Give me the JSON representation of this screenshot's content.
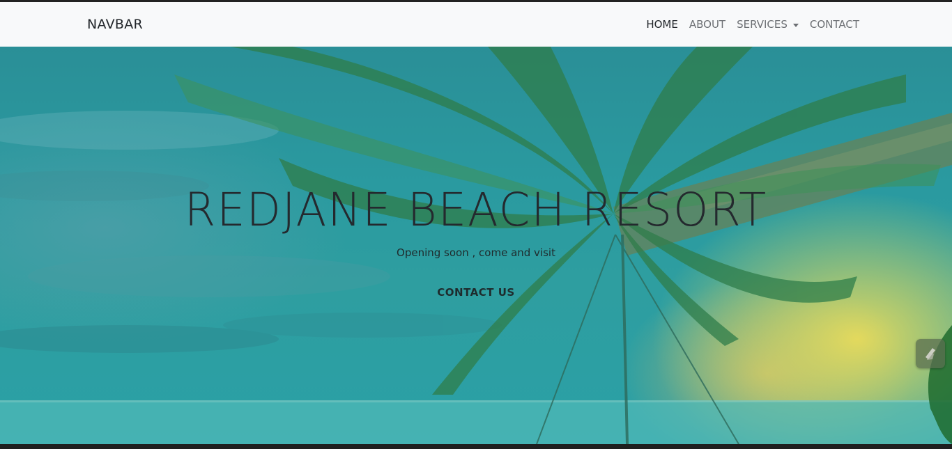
{
  "navbar": {
    "brand": "NAVBAR",
    "links": [
      {
        "label": "HOME",
        "active": true
      },
      {
        "label": "ABOUT",
        "active": false
      },
      {
        "label": "SERVICES",
        "active": false,
        "dropdown": true
      },
      {
        "label": "CONTACT",
        "active": false
      }
    ]
  },
  "hero": {
    "title": "REDJANE BEACH RESORT",
    "subtitle": "Opening soon , come and visit",
    "cta_label": "CONTACT US",
    "background": "beach-palm-sunset-image"
  },
  "widget": {
    "icon": "extension-icon"
  },
  "colors": {
    "navbar_bg": "#f8f9fa",
    "nav_active": "#212529",
    "nav_inactive": "#6c6f73",
    "hero_teal": "#2a9aa0",
    "title_text": "#24292e"
  }
}
